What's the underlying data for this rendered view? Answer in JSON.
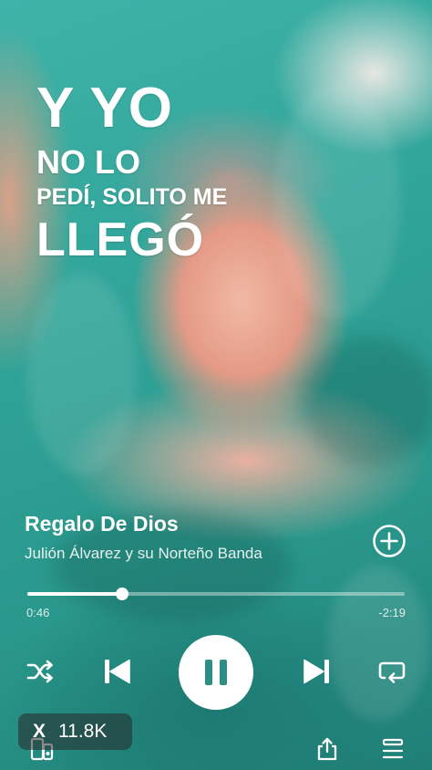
{
  "lyrics": {
    "line1": "Y YO",
    "line2": "NO LO",
    "line3": "PEDÍ, SOLITO ME",
    "line4": "LLEGÓ"
  },
  "track": {
    "title": "Regalo De Dios",
    "artist": "Julión Álvarez y su Norteño Banda"
  },
  "progress": {
    "elapsed": "0:46",
    "remaining": "-2:19",
    "fraction": 0.25
  },
  "social": {
    "platform_mark": "X",
    "views": "11.8K"
  },
  "icons": {
    "add": "plus-circle-icon",
    "shuffle": "shuffle-icon",
    "previous": "skip-previous-icon",
    "pause": "pause-icon",
    "next": "skip-next-icon",
    "repeat": "repeat-icon",
    "devices": "devices-icon",
    "share": "share-icon",
    "queue": "queue-icon"
  }
}
